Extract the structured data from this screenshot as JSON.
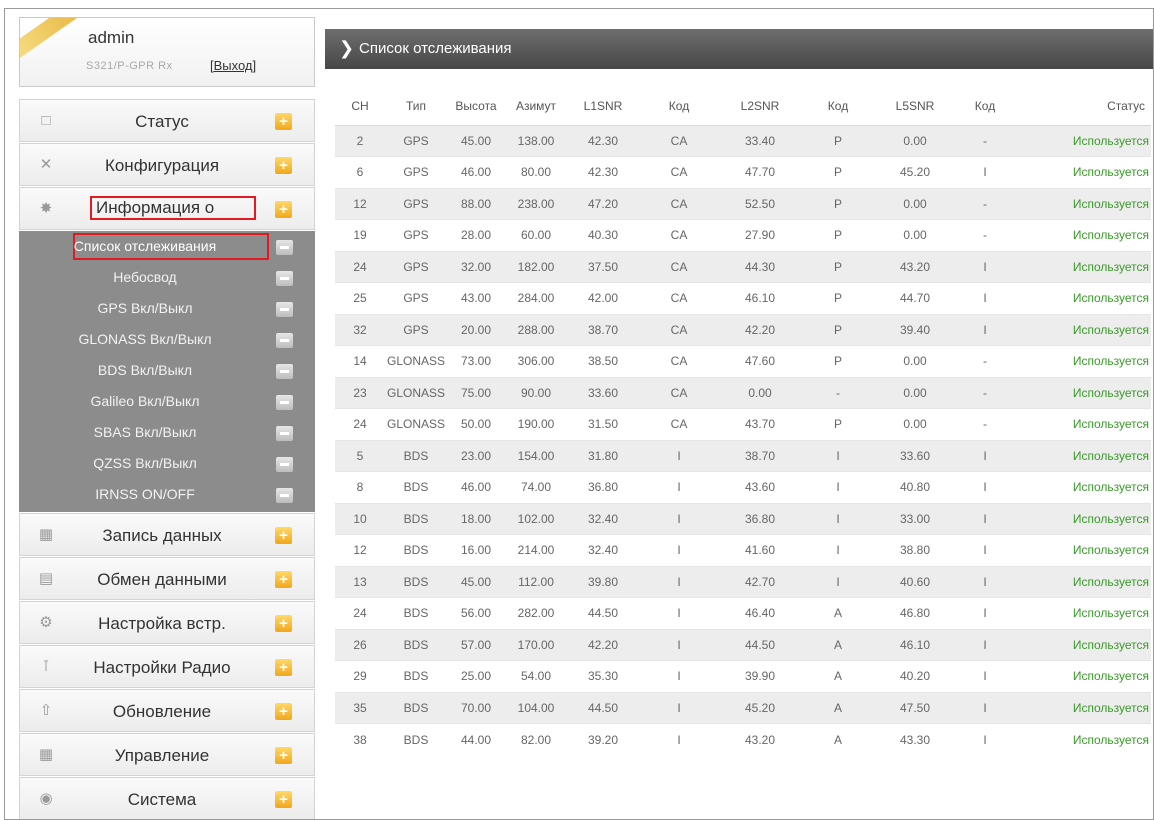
{
  "user": {
    "name": "admin",
    "model": "S321/P-GPR Rx",
    "logout_label": "[Выход]"
  },
  "menu": {
    "items_top": [
      {
        "label": "Статус",
        "icon": "monitor-icon"
      },
      {
        "label": "Конфигурация",
        "icon": "tools-icon"
      },
      {
        "label": "Информация о",
        "icon": "satellite-icon"
      }
    ],
    "submenu": [
      {
        "label": "Список отслеживания"
      },
      {
        "label": "Небосвод"
      },
      {
        "label": "GPS Вкл/Выкл"
      },
      {
        "label": "GLONASS Вкл/Выкл"
      },
      {
        "label": "BDS Вкл/Выкл"
      },
      {
        "label": "Galileo Вкл/Выкл"
      },
      {
        "label": "SBAS Вкл/Выкл"
      },
      {
        "label": "QZSS Вкл/Выкл"
      },
      {
        "label": "IRNSS ON/OFF"
      }
    ],
    "items_bottom": [
      {
        "label": "Запись данных",
        "icon": "calendar-icon"
      },
      {
        "label": "Обмен данными",
        "icon": "computer-icon"
      },
      {
        "label": "Настройка встр.",
        "icon": "gear-icon"
      },
      {
        "label": "Настройки Радио",
        "icon": "antenna-icon"
      },
      {
        "label": "Обновление",
        "icon": "upload-icon"
      },
      {
        "label": "Управление",
        "icon": "calendar-icon"
      },
      {
        "label": "Система",
        "icon": "globe-icon"
      }
    ]
  },
  "panel": {
    "title": "Список отслеживания"
  },
  "table": {
    "headers": [
      "CH",
      "Тип",
      "Высота",
      "Азимут",
      "L1SNR",
      "Код",
      "L2SNR",
      "Код",
      "L5SNR",
      "Код",
      "Статус"
    ],
    "rows": [
      [
        "2",
        "GPS",
        "45.00",
        "138.00",
        "42.30",
        "CA",
        "33.40",
        "P",
        "0.00",
        "-",
        "Используется"
      ],
      [
        "6",
        "GPS",
        "46.00",
        "80.00",
        "42.30",
        "CA",
        "47.70",
        "P",
        "45.20",
        "I",
        "Используется"
      ],
      [
        "12",
        "GPS",
        "88.00",
        "238.00",
        "47.20",
        "CA",
        "52.50",
        "P",
        "0.00",
        "-",
        "Используется"
      ],
      [
        "19",
        "GPS",
        "28.00",
        "60.00",
        "40.30",
        "CA",
        "27.90",
        "P",
        "0.00",
        "-",
        "Используется"
      ],
      [
        "24",
        "GPS",
        "32.00",
        "182.00",
        "37.50",
        "CA",
        "44.30",
        "P",
        "43.20",
        "I",
        "Используется"
      ],
      [
        "25",
        "GPS",
        "43.00",
        "284.00",
        "42.00",
        "CA",
        "46.10",
        "P",
        "44.70",
        "I",
        "Используется"
      ],
      [
        "32",
        "GPS",
        "20.00",
        "288.00",
        "38.70",
        "CA",
        "42.20",
        "P",
        "39.40",
        "I",
        "Используется"
      ],
      [
        "14",
        "GLONASS",
        "73.00",
        "306.00",
        "38.50",
        "CA",
        "47.60",
        "P",
        "0.00",
        "-",
        "Используется"
      ],
      [
        "23",
        "GLONASS",
        "75.00",
        "90.00",
        "33.60",
        "CA",
        "0.00",
        "-",
        "0.00",
        "-",
        "Используется"
      ],
      [
        "24",
        "GLONASS",
        "50.00",
        "190.00",
        "31.50",
        "CA",
        "43.70",
        "P",
        "0.00",
        "-",
        "Используется"
      ],
      [
        "5",
        "BDS",
        "23.00",
        "154.00",
        "31.80",
        "I",
        "38.70",
        "I",
        "33.60",
        "I",
        "Используется"
      ],
      [
        "8",
        "BDS",
        "46.00",
        "74.00",
        "36.80",
        "I",
        "43.60",
        "I",
        "40.80",
        "I",
        "Используется"
      ],
      [
        "10",
        "BDS",
        "18.00",
        "102.00",
        "32.40",
        "I",
        "36.80",
        "I",
        "33.00",
        "I",
        "Используется"
      ],
      [
        "12",
        "BDS",
        "16.00",
        "214.00",
        "32.40",
        "I",
        "41.60",
        "I",
        "38.80",
        "I",
        "Используется"
      ],
      [
        "13",
        "BDS",
        "45.00",
        "112.00",
        "39.80",
        "I",
        "42.70",
        "I",
        "40.60",
        "I",
        "Используется"
      ],
      [
        "24",
        "BDS",
        "56.00",
        "282.00",
        "44.50",
        "I",
        "46.40",
        "A",
        "46.80",
        "I",
        "Используется"
      ],
      [
        "26",
        "BDS",
        "57.00",
        "170.00",
        "42.20",
        "I",
        "44.50",
        "A",
        "46.10",
        "I",
        "Используется"
      ],
      [
        "29",
        "BDS",
        "25.00",
        "54.00",
        "35.30",
        "I",
        "39.90",
        "A",
        "40.20",
        "I",
        "Используется"
      ],
      [
        "35",
        "BDS",
        "70.00",
        "104.00",
        "44.50",
        "I",
        "45.20",
        "A",
        "47.50",
        "I",
        "Используется"
      ],
      [
        "38",
        "BDS",
        "44.00",
        "82.00",
        "39.20",
        "I",
        "43.20",
        "A",
        "43.30",
        "I",
        "Используется"
      ]
    ]
  },
  "colors": {
    "status_green": "#3a9a2a",
    "highlight_red": "#e11b22",
    "accent_orange": "#f1a71a",
    "submenu_bg": "#8c8c8c",
    "header_bg": "#5a5a5a"
  }
}
